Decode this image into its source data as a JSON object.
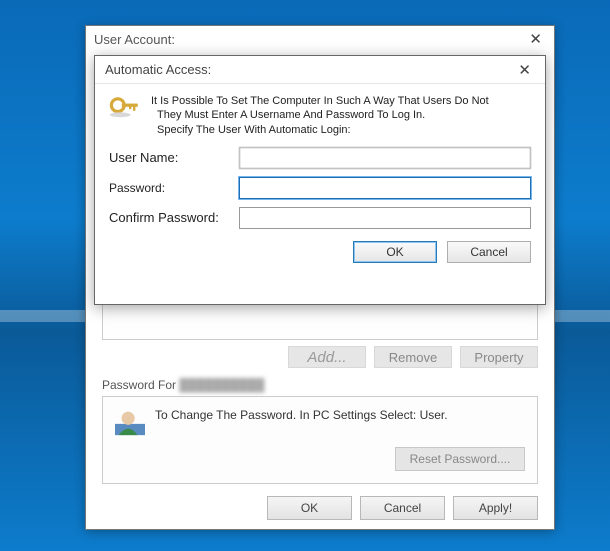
{
  "desktop": {
    "accent": "#0d7ccc"
  },
  "parent": {
    "title": "User Account:",
    "close_glyph": "✕",
    "buttons": {
      "add": "Add...",
      "remove": "Remove",
      "property": "Property"
    },
    "pw_section_label": "Password For",
    "pw_section_user": "██████████",
    "pw_text": "To Change The Password. In PC Settings Select: User.",
    "reset_label": "Reset Password....",
    "footer": {
      "ok": "OK",
      "cancel": "Cancel",
      "apply": "Apply!"
    }
  },
  "dialog": {
    "title": "Automatic Access:",
    "close_glyph": "✕",
    "intro_line1": "It Is Possible To Set The Computer In Such A Way That Users Do Not",
    "intro_line2": "They Must Enter A Username And Password To Log In.",
    "intro_line3": "Specify The User With Automatic Login:",
    "labels": {
      "username": "User Name:",
      "password": "Password:",
      "confirm": "Confirm Password:"
    },
    "values": {
      "username": "",
      "password": "",
      "confirm": ""
    },
    "buttons": {
      "ok": "OK",
      "cancel": "Cancel"
    }
  }
}
